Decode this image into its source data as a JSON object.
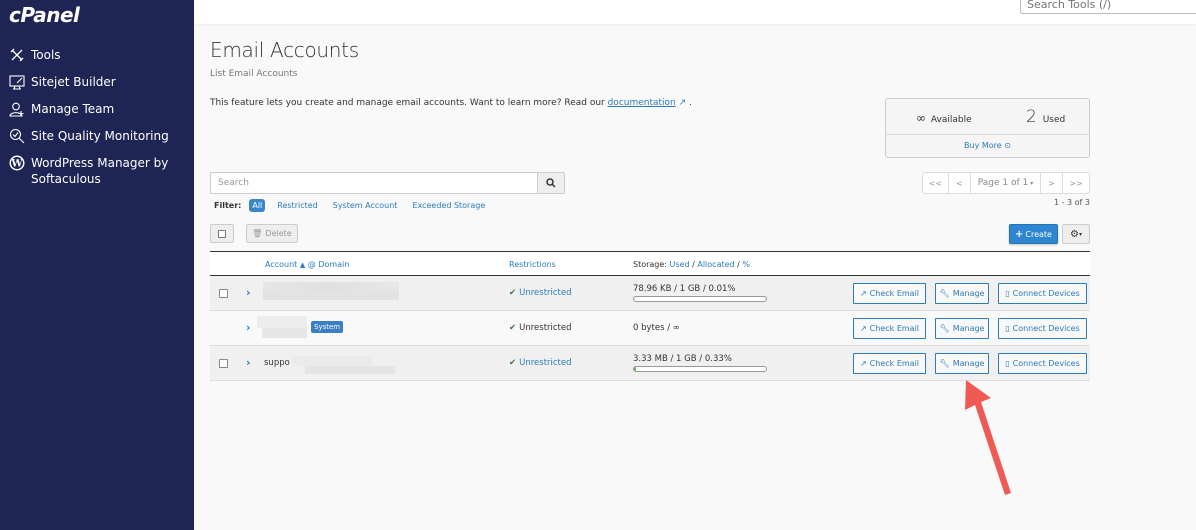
{
  "sidebar": {
    "logo": "cPanel",
    "items": [
      {
        "label": "Tools",
        "icon": "tools-icon"
      },
      {
        "label": "Sitejet Builder",
        "icon": "monitor-brush-icon"
      },
      {
        "label": "Manage Team",
        "icon": "user-add-icon"
      },
      {
        "label": "Site Quality Monitoring",
        "icon": "search-check-icon"
      },
      {
        "label": "WordPress Manager by Softaculous",
        "icon": "wordpress-icon"
      }
    ]
  },
  "topbar": {
    "search_placeholder": "Search Tools (/)"
  },
  "page": {
    "title": "Email Accounts",
    "subtitle": "List Email Accounts",
    "intro_text": "This feature lets you create and manage email accounts. Want to learn more? Read our ",
    "intro_link": "documentation",
    "intro_end": " ."
  },
  "stats": {
    "available_value": "∞",
    "available_label": "Available",
    "used_value": "2",
    "used_label": "Used",
    "buy_more": "Buy More"
  },
  "search": {
    "placeholder": "Search"
  },
  "filter": {
    "label": "Filter:",
    "options": [
      "All",
      "Restricted",
      "System Account",
      "Exceeded Storage"
    ],
    "active": "All"
  },
  "toolbar": {
    "delete_label": "Delete",
    "create_label": "Create"
  },
  "pagination": {
    "first": "<<",
    "prev": "<",
    "page_label": "Page 1 of 1",
    "next": ">",
    "last": ">>",
    "range": "1 - 3 of 3"
  },
  "table": {
    "headers": {
      "account": "Account",
      "at_domain": "@ Domain",
      "restrictions": "Restrictions",
      "storage_prefix": "Storage:",
      "used": "Used",
      "allocated": "Allocated",
      "percent": "%"
    },
    "rows": [
      {
        "account": "",
        "system": false,
        "restriction": "Unrestricted",
        "storage": "78.96 KB / 1 GB / 0.01%",
        "usage_percent": 0.01,
        "has_bar": true,
        "has_checkbox": true
      },
      {
        "account": "",
        "system": true,
        "system_label": "System",
        "restriction": "Unrestricted",
        "storage": "0 bytes / ∞",
        "has_bar": false,
        "has_checkbox": false
      },
      {
        "account": "suppo",
        "system": false,
        "restriction": "Unrestricted",
        "storage": "3.33 MB / 1 GB / 0.33%",
        "usage_percent": 0.33,
        "has_bar": true,
        "has_checkbox": true
      }
    ],
    "actions": {
      "check_email": "Check Email",
      "manage": "Manage",
      "connect_devices": "Connect Devices"
    }
  },
  "colors": {
    "sidebar_bg": "#1e2454",
    "primary": "#2e86d1",
    "link": "#2b7bbd",
    "success": "#3c763d",
    "annotation_arrow": "#f05a55"
  }
}
